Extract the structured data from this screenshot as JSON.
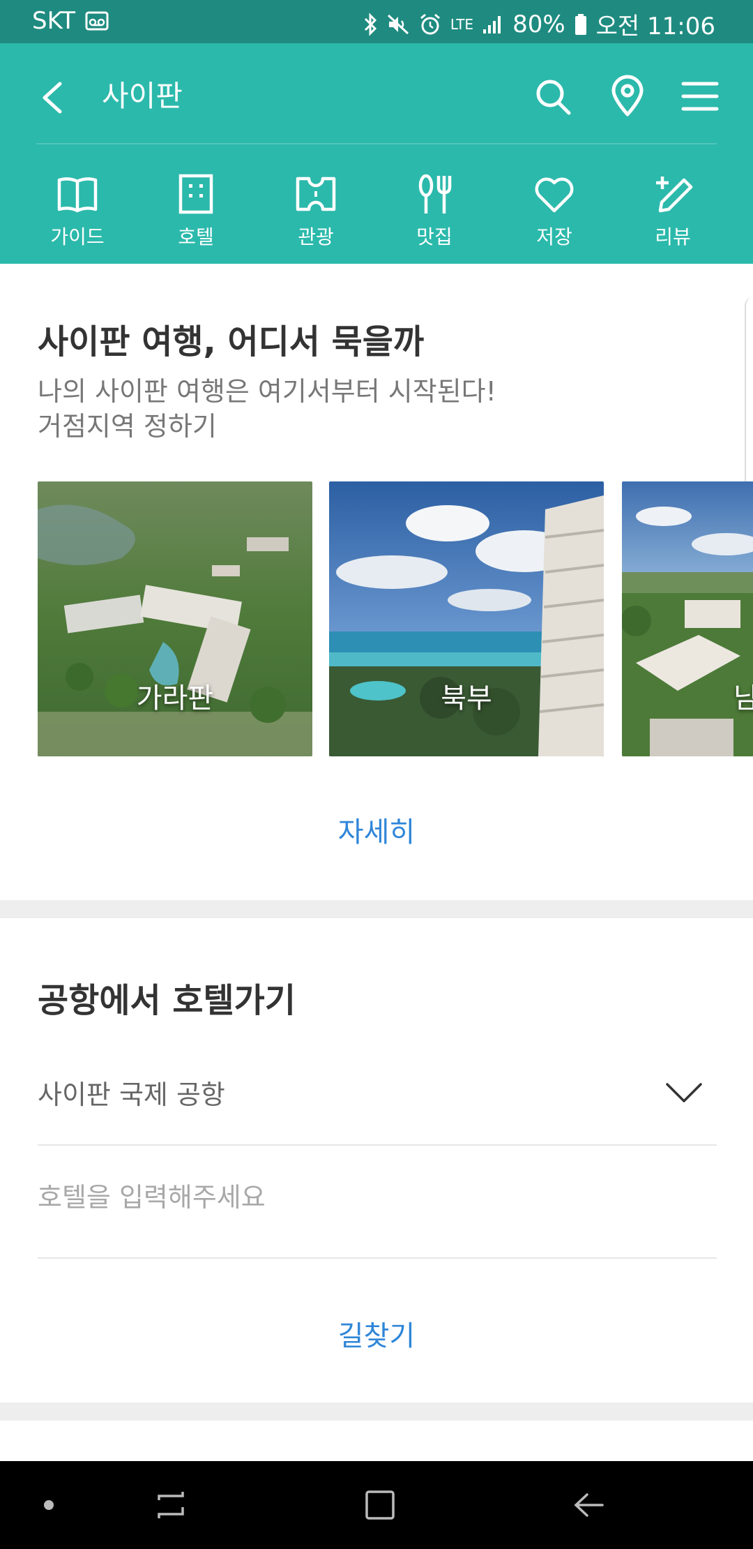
{
  "status_bar": {
    "carrier": "SKT",
    "network": "LTE",
    "battery": "80%",
    "time": "오전 11:06"
  },
  "header": {
    "title": "사이판"
  },
  "nav": {
    "items": [
      {
        "label": "가이드",
        "icon": "book-icon"
      },
      {
        "label": "호텔",
        "icon": "hotel-icon"
      },
      {
        "label": "관광",
        "icon": "ticket-icon"
      },
      {
        "label": "맛집",
        "icon": "restaurant-icon"
      },
      {
        "label": "저장",
        "icon": "heart-icon"
      },
      {
        "label": "리뷰",
        "icon": "edit-icon"
      }
    ]
  },
  "stay": {
    "title": "사이판 여행, 어디서 묵을까",
    "subtitle_line1": "나의 사이판 여행은 여기서부터 시작된다!",
    "subtitle_line2": "거점지역 정하기",
    "cards": [
      {
        "label": "가라판"
      },
      {
        "label": "북부"
      },
      {
        "label": "남부"
      }
    ],
    "more_label": "자세히"
  },
  "airport": {
    "title": "공항에서 호텔가기",
    "airport_value": "사이판 국제 공항",
    "hotel_placeholder": "호텔을 입력해주세요",
    "route_label": "길찾기"
  },
  "colors": {
    "header_bg": "#2bb9ab",
    "status_bg": "#1f8b80",
    "link": "#2f86d8"
  }
}
